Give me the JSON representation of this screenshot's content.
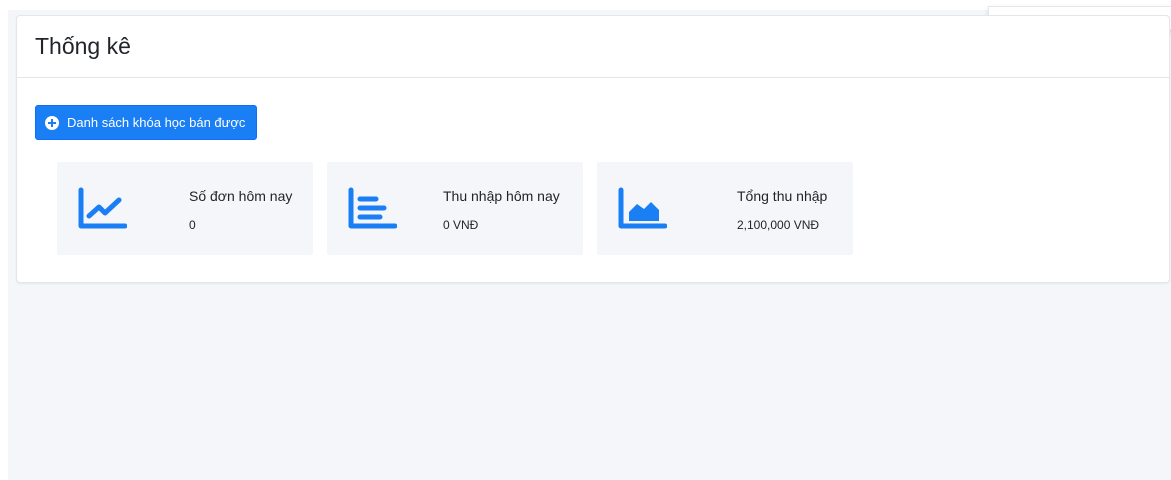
{
  "header": {
    "title": "Thống kê"
  },
  "actions": {
    "sold_courses_label": "Danh sách khóa học bán được"
  },
  "stats": [
    {
      "label": "Số đơn hôm nay",
      "value": "0",
      "icon": "chart-line-icon"
    },
    {
      "label": "Thu nhập hôm nay",
      "value": "0 VNĐ",
      "icon": "chart-bar-icon"
    },
    {
      "label": "Tổng thu nhập",
      "value": "2,100,000 VNĐ",
      "icon": "chart-area-icon"
    }
  ],
  "colors": {
    "primary": "#1a7ef5",
    "page_background": "#f4f6f9",
    "card_background": "#ffffff"
  }
}
